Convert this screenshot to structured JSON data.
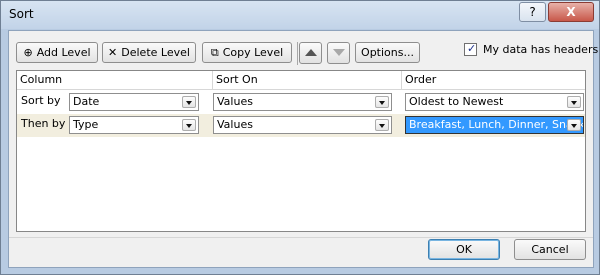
{
  "window": {
    "title": "Sort",
    "help_label": "?",
    "close_label": "X"
  },
  "toolbar": {
    "add_level": "Add Level",
    "delete_level": "Delete Level",
    "copy_level": "Copy Level",
    "options": "Options...",
    "has_headers_label": "My data has headers",
    "has_headers_checked": true
  },
  "grid": {
    "columns": [
      "Column",
      "Sort On",
      "Order"
    ],
    "rows": [
      {
        "label": "Sort by",
        "column": "Date",
        "sort_on": "Values",
        "order": "Oldest to Newest",
        "selected": false
      },
      {
        "label": "Then by",
        "column": "Type",
        "sort_on": "Values",
        "order": "Breakfast, Lunch, Dinner, Snacks",
        "selected": true
      }
    ]
  },
  "footer": {
    "ok": "OK",
    "cancel": "Cancel"
  },
  "icons": [
    "add-level-icon",
    "delete-level-icon",
    "copy-level-icon",
    "move-up-icon",
    "move-down-icon",
    "checkmark-icon",
    "dropdown-arrow-icon"
  ]
}
